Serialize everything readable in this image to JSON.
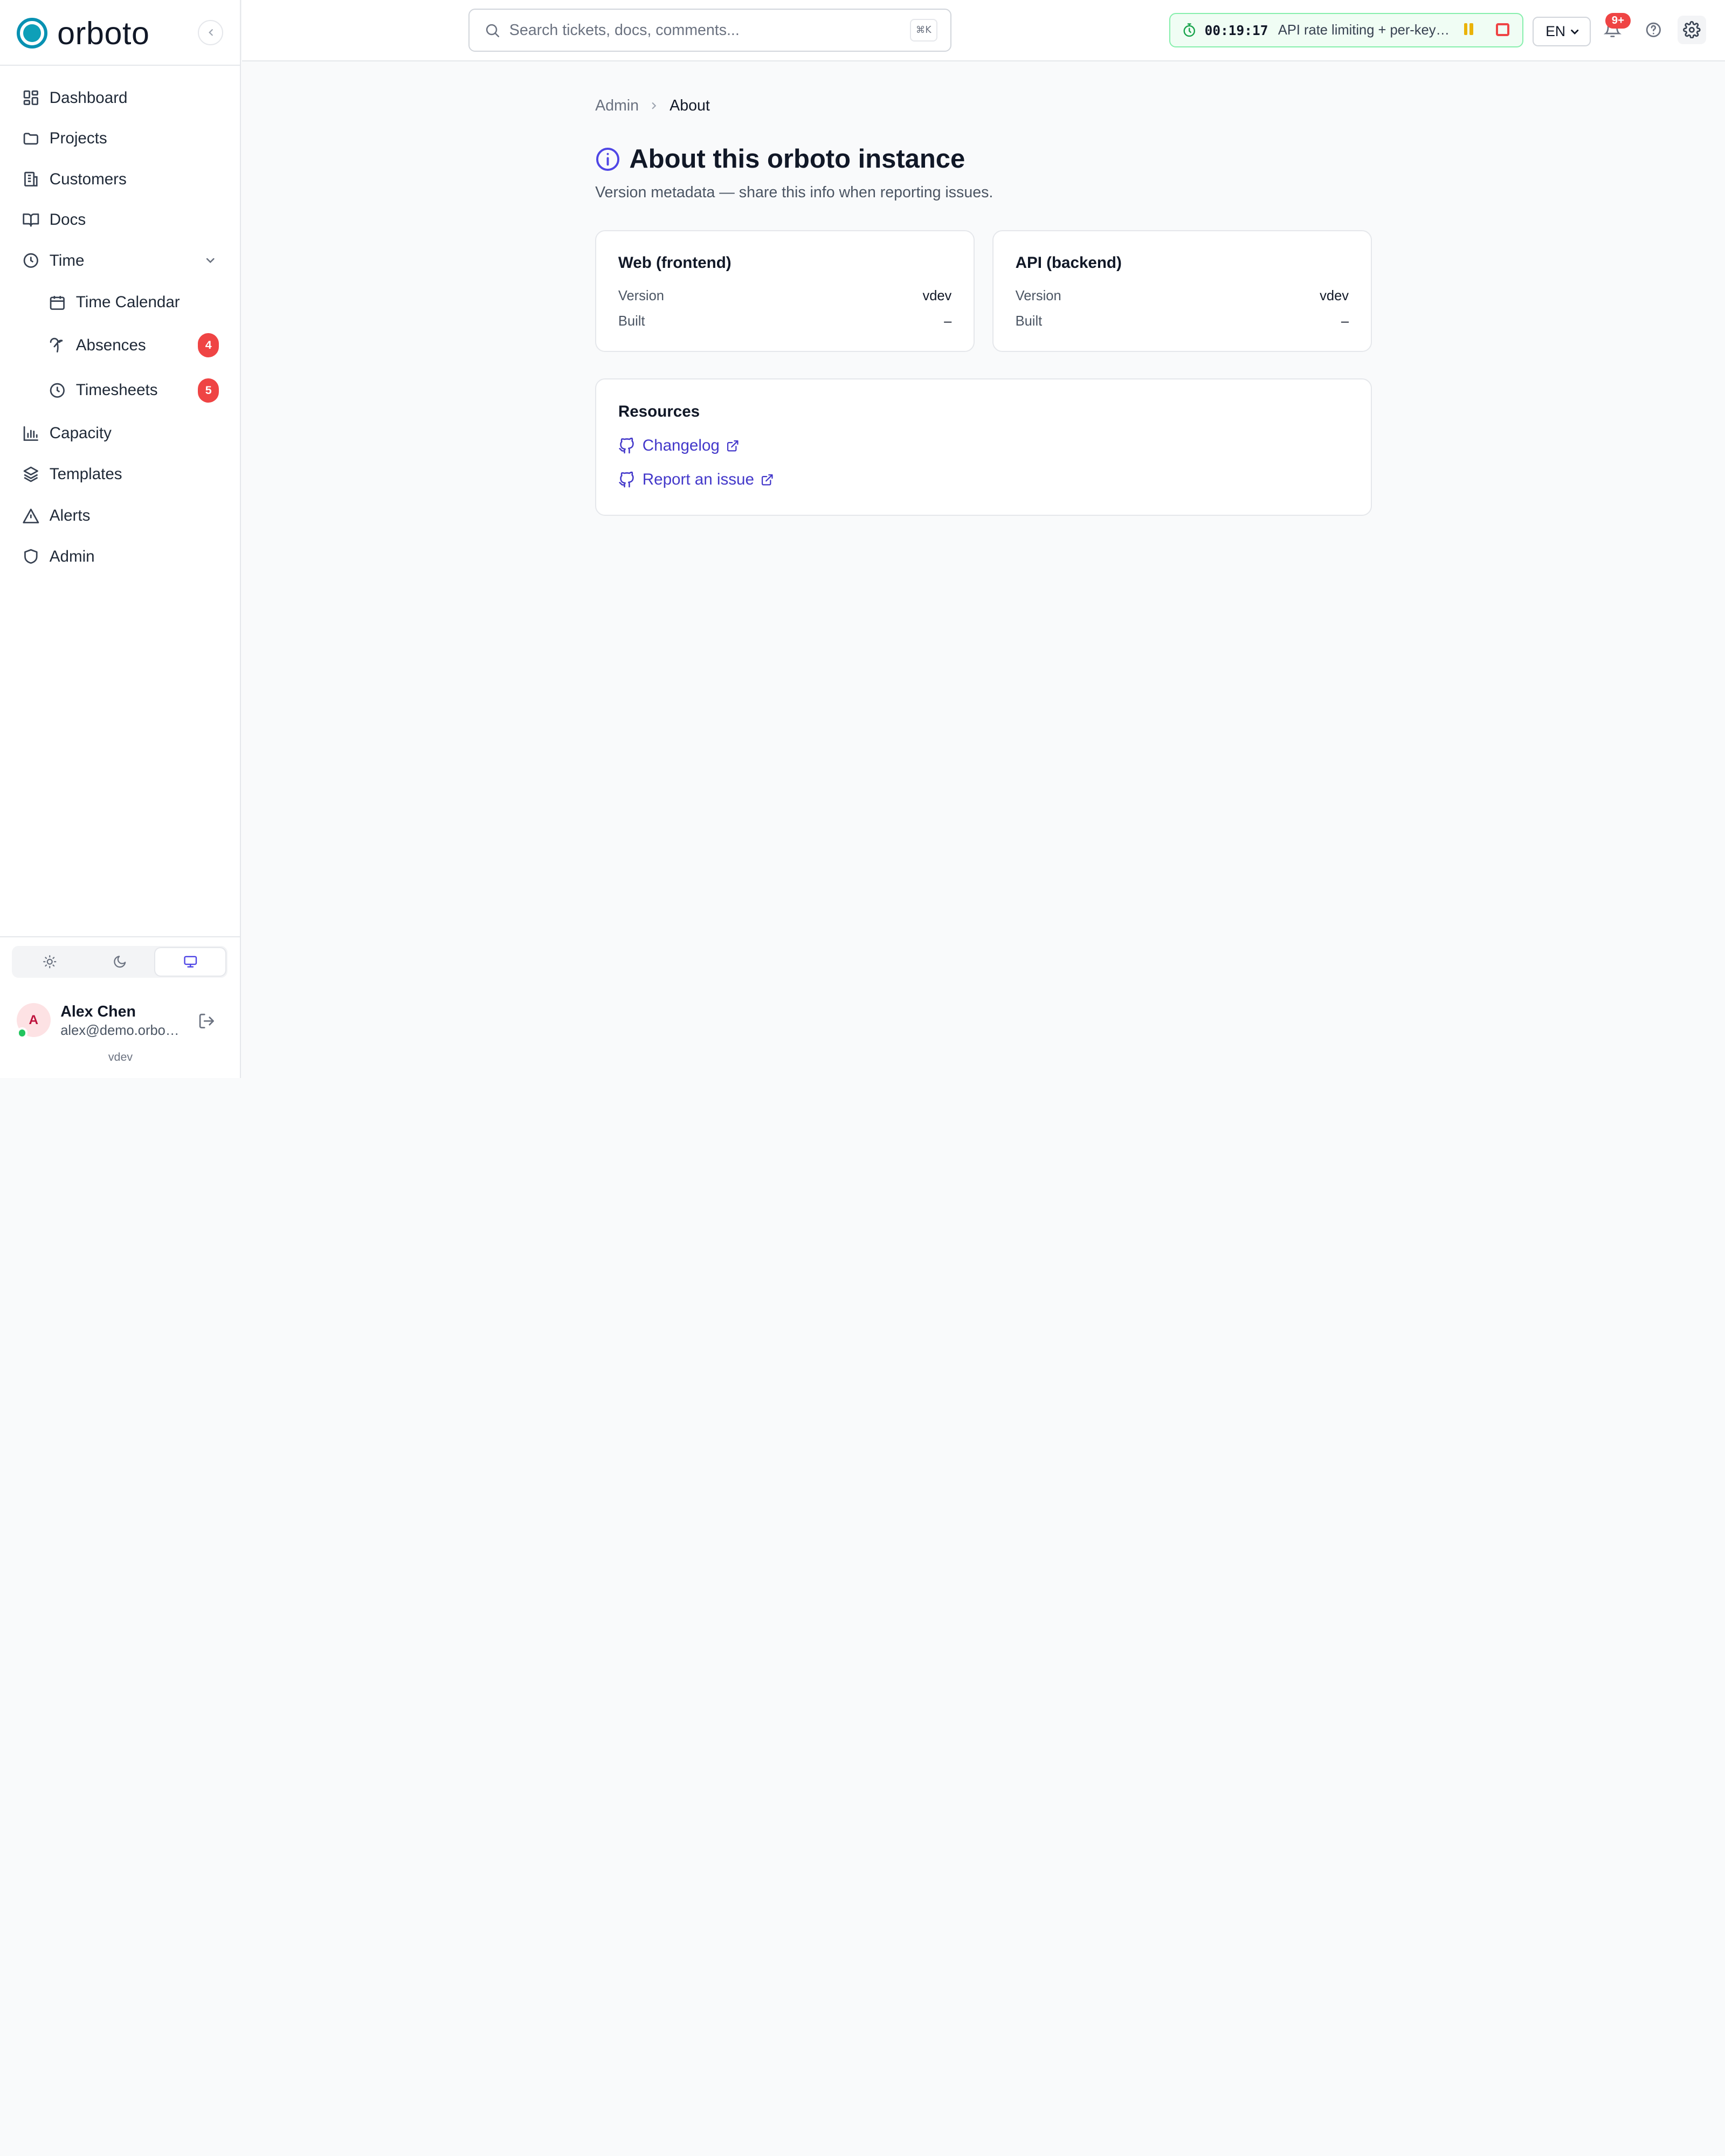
{
  "brand": {
    "name": "orboto"
  },
  "sidebar": {
    "items": [
      {
        "label": "Dashboard",
        "icon": "dashboard-icon"
      },
      {
        "label": "Projects",
        "icon": "folder-icon"
      },
      {
        "label": "Customers",
        "icon": "building-icon"
      },
      {
        "label": "Docs",
        "icon": "book-icon"
      },
      {
        "label": "Time",
        "icon": "clock-icon",
        "expanded": true
      },
      {
        "label": "Time Calendar",
        "icon": "calendar-icon",
        "sub": true
      },
      {
        "label": "Absences",
        "icon": "palm-tree-icon",
        "sub": true,
        "badge": "4"
      },
      {
        "label": "Timesheets",
        "icon": "clock-icon",
        "sub": true,
        "badge": "5"
      },
      {
        "label": "Capacity",
        "icon": "bar-chart-icon"
      },
      {
        "label": "Templates",
        "icon": "layers-icon"
      },
      {
        "label": "Alerts",
        "icon": "alert-triangle-icon"
      },
      {
        "label": "Admin",
        "icon": "shield-icon"
      }
    ],
    "theme_options": [
      "light",
      "dark",
      "system"
    ],
    "theme_selected": "system",
    "user": {
      "initial": "A",
      "name": "Alex Chen",
      "email": "alex@demo.orboto.io",
      "status": "online"
    },
    "version": "vdev"
  },
  "topbar": {
    "search_placeholder": "Search tickets, docs, comments...",
    "search_shortcut": "⌘K",
    "timer": {
      "time": "00:19:17",
      "label": "API rate limiting + per-key quotas"
    },
    "language": "EN",
    "notifications_badge": "9+"
  },
  "breadcrumb": {
    "parent": "Admin",
    "current": "About"
  },
  "page": {
    "title": "About this orboto instance",
    "subtitle": "Version metadata — share this info when reporting issues."
  },
  "cards": {
    "web": {
      "title": "Web (frontend)",
      "version_label": "Version",
      "version": "vdev",
      "built_label": "Built",
      "built": "–"
    },
    "api": {
      "title": "API (backend)",
      "version_label": "Version",
      "version": "vdev",
      "built_label": "Built",
      "built": "–"
    }
  },
  "resources": {
    "title": "Resources",
    "links": [
      {
        "label": "Changelog"
      },
      {
        "label": "Report an issue"
      }
    ]
  },
  "colors": {
    "accent": "#4f46e5",
    "brand": "#0891b2",
    "badge": "#ef4444",
    "timer_bg": "#f0fdf4"
  }
}
